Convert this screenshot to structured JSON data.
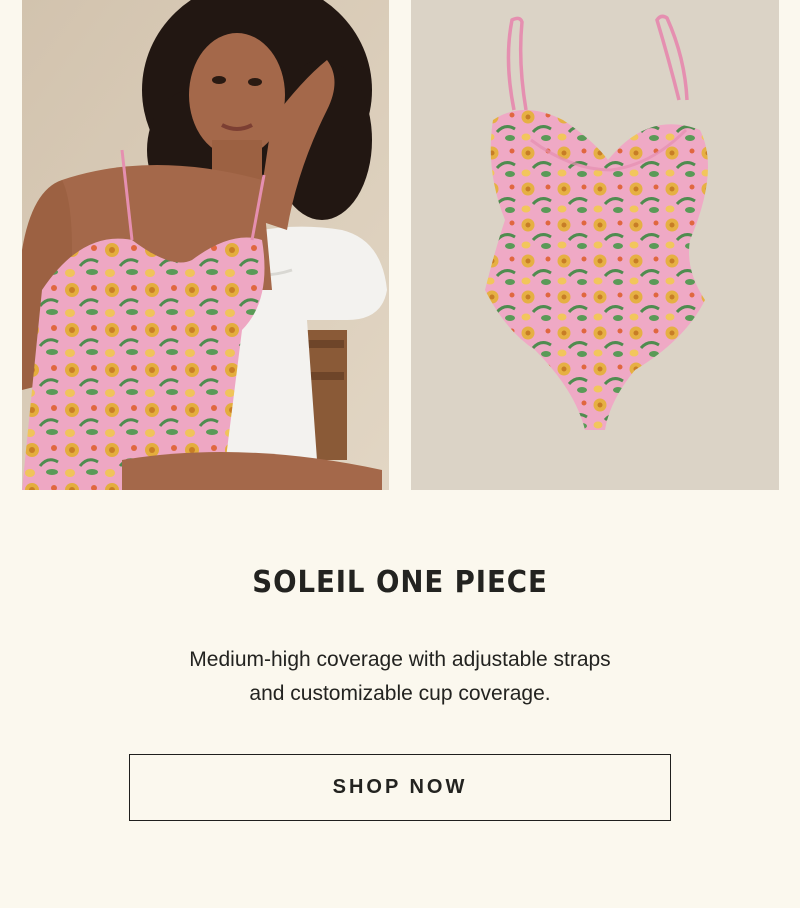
{
  "images": {
    "model_photo": {
      "alt": "model wearing floral one piece swimsuit",
      "icon": "model-photo"
    },
    "product_photo": {
      "alt": "floral one piece swimsuit flat lay",
      "icon": "product-photo"
    }
  },
  "product": {
    "title": "SOLEIL ONE PIECE",
    "description_line1": "Medium-high coverage with adjustable straps",
    "description_line2": "and customizable cup coverage."
  },
  "cta": {
    "label": "SHOP NOW"
  },
  "colors": {
    "background": "#fbf8ee",
    "text": "#232320",
    "swim_pink": "#e9a6c0",
    "print_gold": "#e2a93a",
    "print_green": "#4e8a4e"
  }
}
